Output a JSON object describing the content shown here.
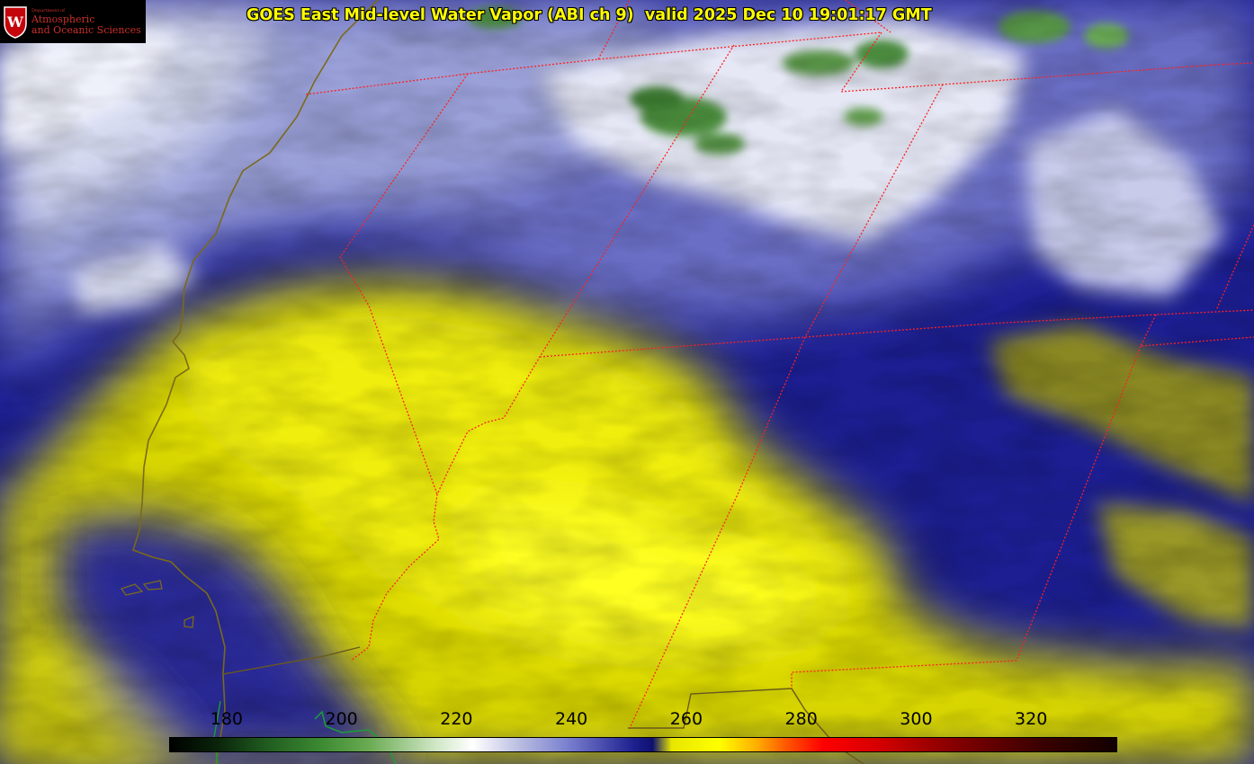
{
  "title": "GOES East Mid-level Water Vapor (ABI ch 9)  valid 2025 Dec 10 19:01:17 GMT",
  "logo": {
    "department": "Department of",
    "line1": "Atmospheric",
    "line2": "and Oceanic Sciences",
    "seal_letter": "W"
  },
  "colorbar": {
    "tick_labels": [
      "180",
      "200",
      "220",
      "240",
      "260",
      "280",
      "300",
      "320"
    ],
    "range": [
      170,
      335
    ]
  },
  "colors": {
    "title": "#ffff00",
    "dry_air": "#ffff00",
    "moist_air": "#1a1c8f",
    "cloud_tops": "#ffffff",
    "cold_cloud_tops": "#3c8a32",
    "state_borders": "#ff2020",
    "coastlines": "#7a6a1a"
  }
}
